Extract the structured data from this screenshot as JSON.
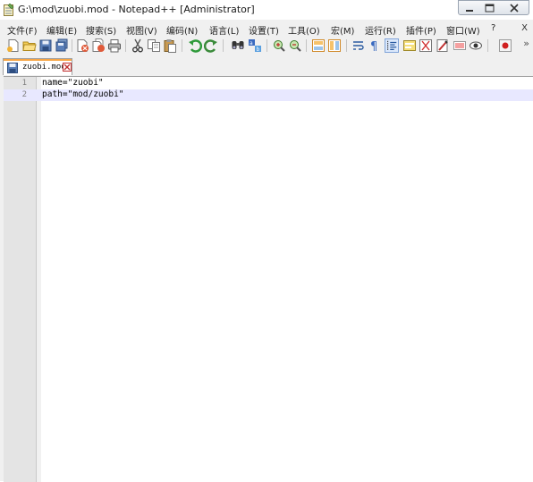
{
  "window": {
    "title": "G:\\mod\\zuobi.mod - Notepad++ [Administrator]",
    "icon": "notepad-icon"
  },
  "menu": {
    "items": [
      {
        "label": "文件(F)"
      },
      {
        "label": "编辑(E)"
      },
      {
        "label": "搜索(S)"
      },
      {
        "label": "视图(V)"
      },
      {
        "label": "编码(N)"
      },
      {
        "label": "语言(L)"
      },
      {
        "label": "设置(T)"
      },
      {
        "label": "工具(O)"
      },
      {
        "label": "宏(M)"
      },
      {
        "label": "运行(R)"
      },
      {
        "label": "插件(P)"
      },
      {
        "label": "窗口(W)"
      },
      {
        "label": "?"
      }
    ],
    "close_label": "X"
  },
  "toolbar": {
    "overflow_label": "»",
    "icons": [
      "new-file-icon",
      "open-file-icon",
      "save-icon",
      "save-all-icon",
      "close-icon",
      "close-all-icon",
      "print-icon",
      "cut-icon",
      "copy-icon",
      "paste-icon",
      "undo-icon",
      "redo-icon",
      "find-icon",
      "replace-icon",
      "zoom-in-icon",
      "zoom-out-icon",
      "sync-vertical-icon",
      "sync-horizontal-icon",
      "word-wrap-icon",
      "show-all-chars-icon",
      "indent-guide-icon",
      "user-language-icon",
      "function-list-icon",
      "folder-workspace-icon",
      "doc-map-icon",
      "monitor-icon",
      "record-macro-icon"
    ]
  },
  "tabs": [
    {
      "label": "zuobi.mod",
      "active": true
    }
  ],
  "editor": {
    "lines": [
      {
        "number": "1",
        "text": "name=\"zuobi\""
      },
      {
        "number": "2",
        "text": "path=\"mod/zuobi\""
      }
    ],
    "current_line": "2"
  },
  "colors": {
    "current_line_bg": "#e8e8ff",
    "gutter_bg": "#e4e4e4",
    "tab_accent": "#f6a545"
  }
}
